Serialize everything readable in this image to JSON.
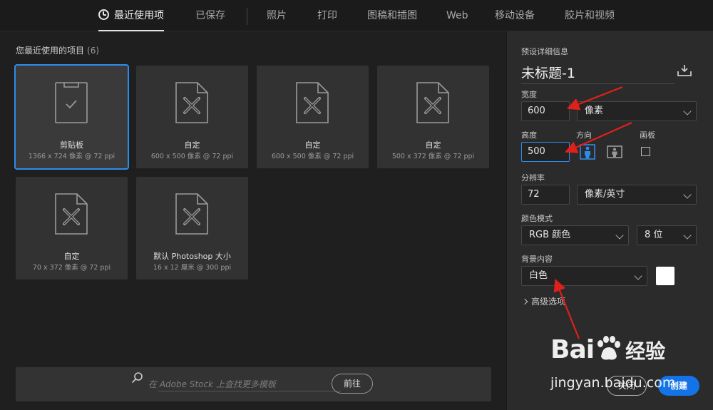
{
  "tabs": [
    {
      "label": "最近使用项",
      "active": true
    },
    {
      "label": "已保存"
    },
    {
      "label": "照片"
    },
    {
      "label": "打印"
    },
    {
      "label": "图稿和插图"
    },
    {
      "label": "Web"
    },
    {
      "label": "移动设备"
    },
    {
      "label": "胶片和视频"
    }
  ],
  "recent": {
    "title": "您最近使用的项目",
    "count": "(6)",
    "items": [
      {
        "name": "剪贴板",
        "meta": "1366 x 724 像素 @ 72 ppi",
        "icon": "clipboard-doc-icon",
        "selected": true
      },
      {
        "name": "自定",
        "meta": "600 x 500 像素 @ 72 ppi",
        "icon": "custom-doc-icon"
      },
      {
        "name": "自定",
        "meta": "600 x 500 像素 @ 72 ppi",
        "icon": "custom-doc-icon"
      },
      {
        "name": "自定",
        "meta": "500 x 372 像素 @ 72 ppi",
        "icon": "custom-doc-icon"
      },
      {
        "name": "自定",
        "meta": "70 x 372 像素 @ 72 ppi",
        "icon": "custom-doc-icon"
      },
      {
        "name": "默认 Photoshop 大小",
        "meta": "16 x 12 厘米 @ 300 ppi",
        "icon": "custom-doc-icon"
      }
    ]
  },
  "stock": {
    "placeholder": "在 Adobe Stock 上查找更多模板",
    "go_label": "前往"
  },
  "preset": {
    "section_label": "预设详细信息",
    "doc_name": "未标题-1",
    "width_label": "宽度",
    "width_value": "600",
    "width_unit": "像素",
    "height_label": "高度",
    "height_value": "500",
    "orientation_label": "方向",
    "artboard_label": "画板",
    "resolution_label": "分辨率",
    "resolution_value": "72",
    "resolution_unit": "像素/英寸",
    "color_mode_label": "颜色模式",
    "color_mode": "RGB 颜色",
    "bit_depth": "8 位",
    "background_label": "背景内容",
    "background_value": "白色",
    "background_color": "#ffffff",
    "advanced_label": "高级选项",
    "close_label": "关闭",
    "create_label": "创建"
  },
  "watermark": {
    "brand": "Bai",
    "brand_suffix": "经验",
    "url": "jingyan.baidu.com"
  },
  "colors": {
    "accent": "#1473e6",
    "selection": "#2d8ceb",
    "annotation_arrow": "#e0201b"
  }
}
